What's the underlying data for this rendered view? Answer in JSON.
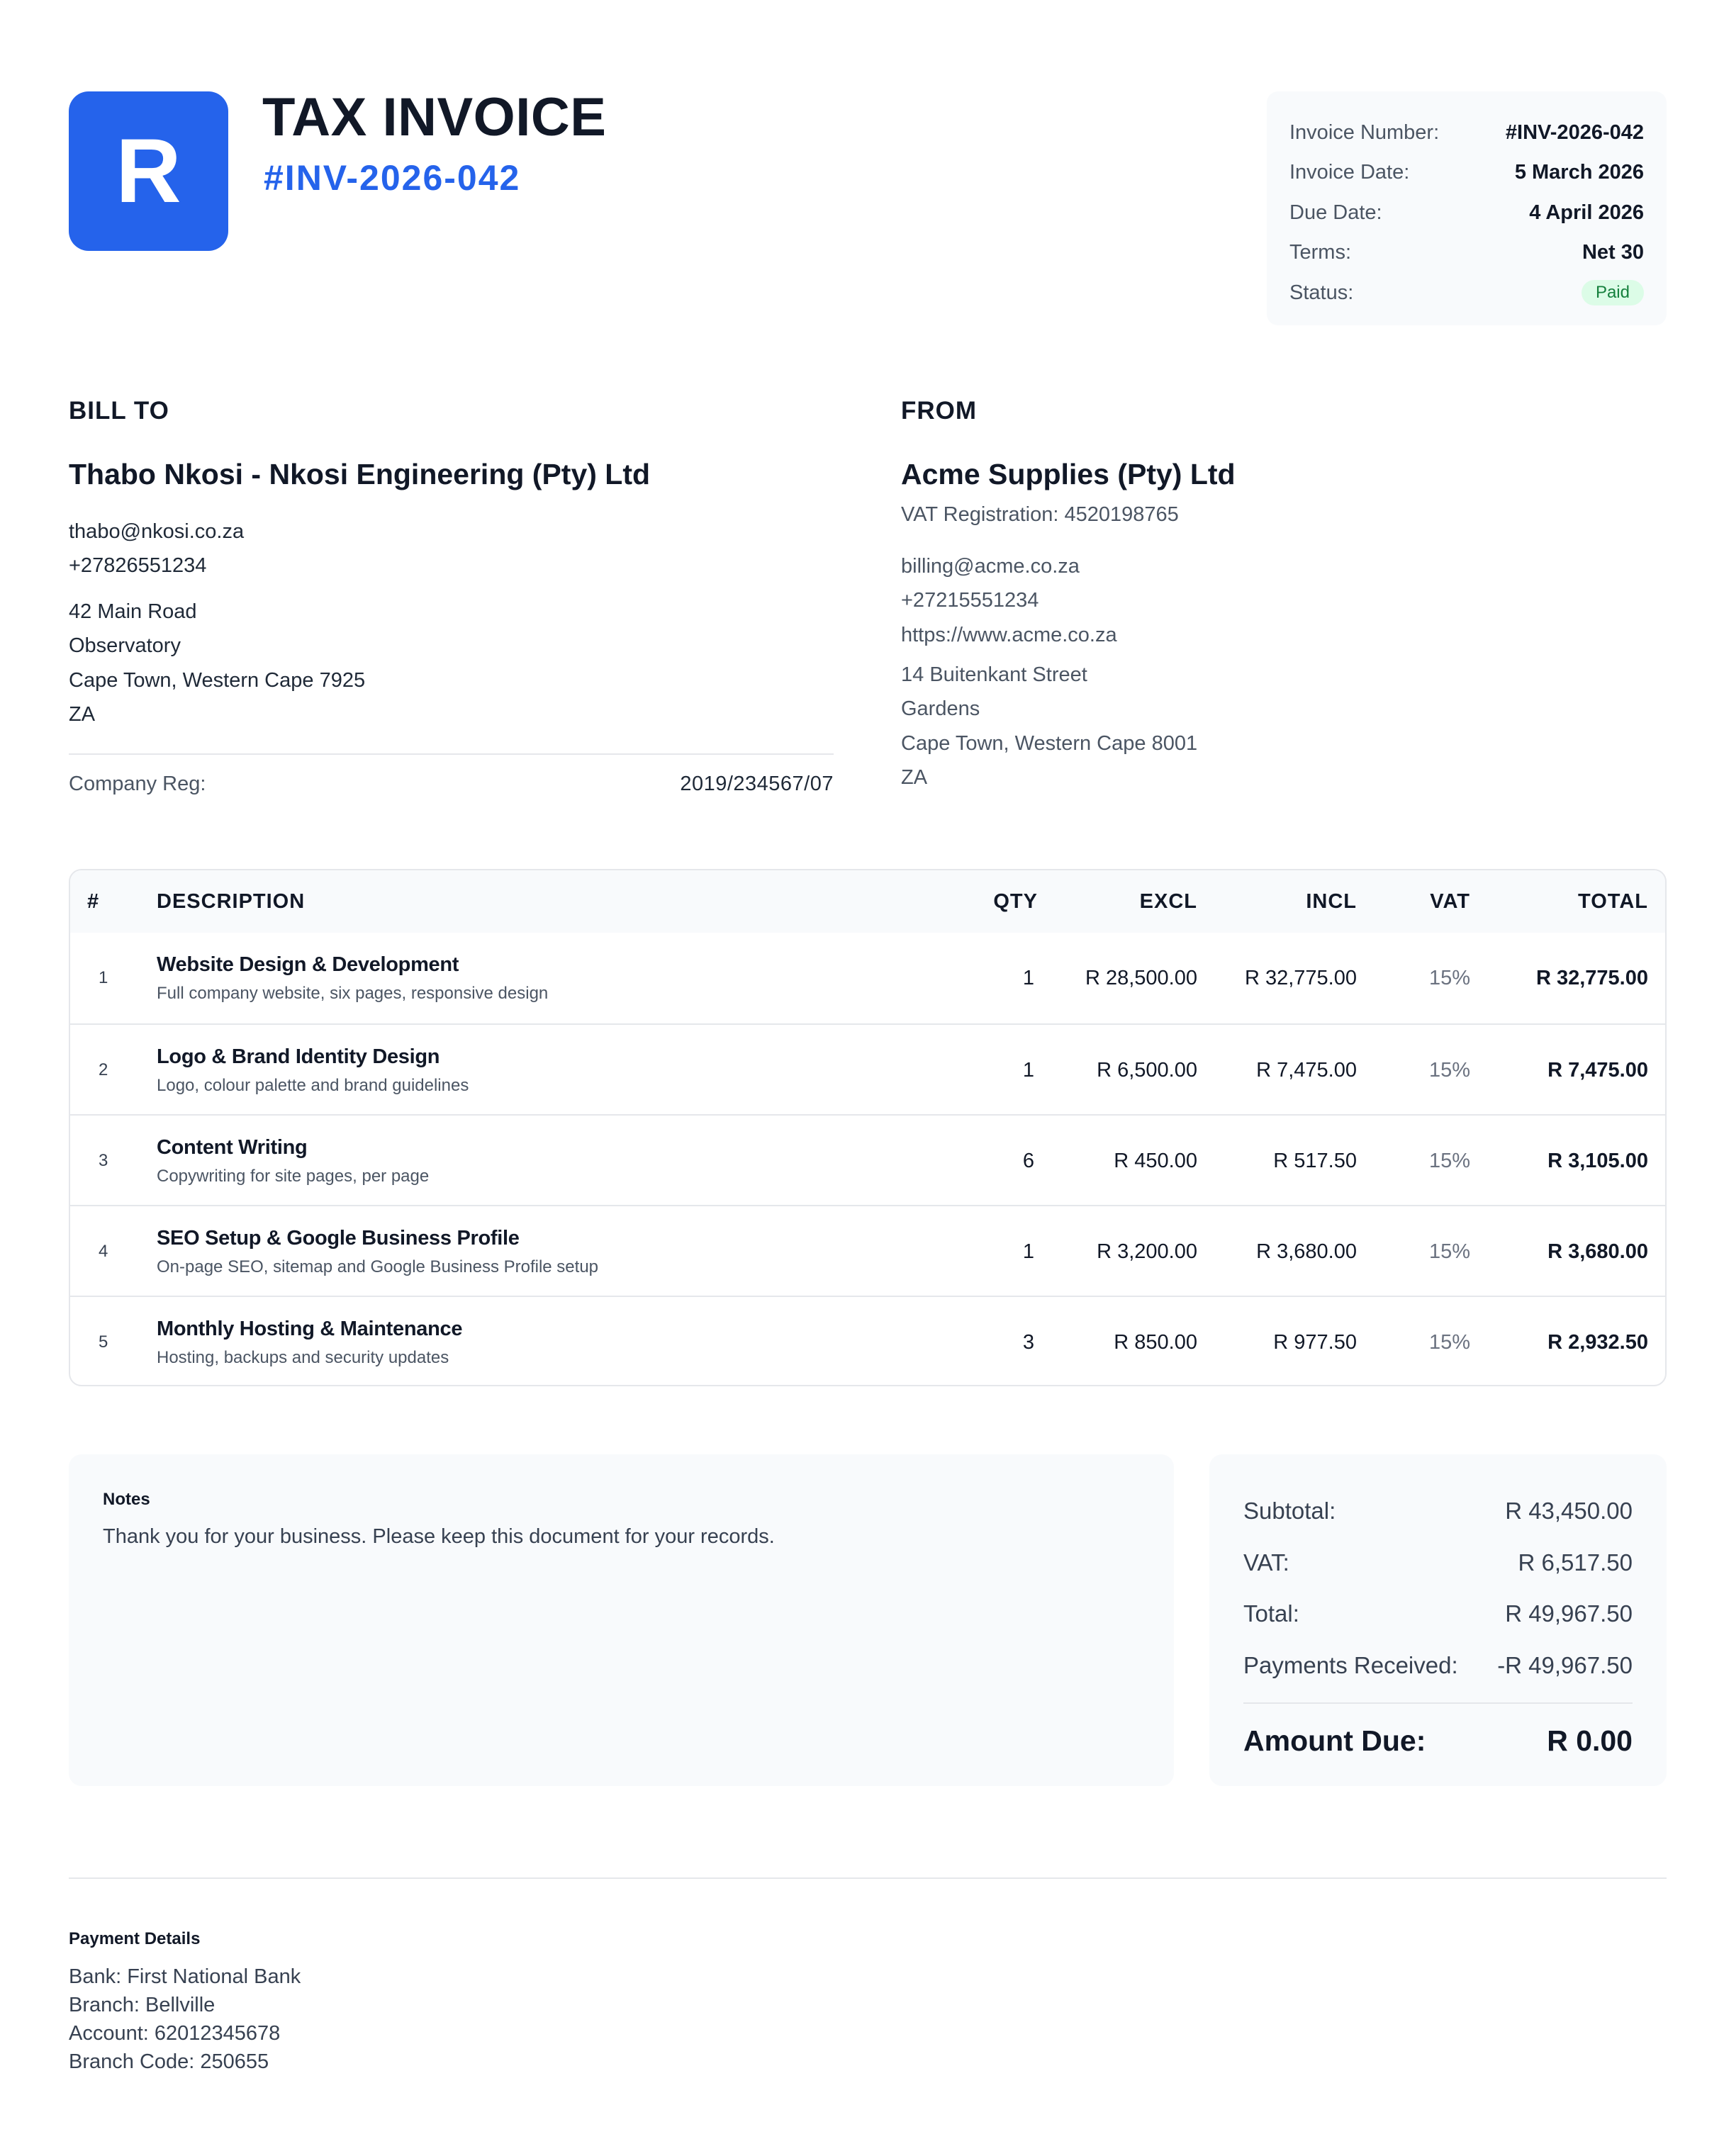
{
  "header": {
    "logo_letter": "R",
    "title": "TAX INVOICE",
    "number": "#INV-2026-042"
  },
  "meta": {
    "invoice_number_label": "Invoice Number:",
    "invoice_number": "#INV-2026-042",
    "invoice_date_label": "Invoice Date:",
    "invoice_date": "5 March 2026",
    "due_date_label": "Due Date:",
    "due_date": "4 April 2026",
    "terms_label": "Terms:",
    "terms": "Net 30",
    "status_label": "Status:",
    "status": "Paid"
  },
  "bill_to": {
    "heading": "BILL TO",
    "name": "Thabo Nkosi - Nkosi Engineering (Pty) Ltd",
    "email": "thabo@nkosi.co.za",
    "phone": "+27826551234",
    "address": [
      "42 Main Road",
      "Observatory",
      "Cape Town, Western Cape 7925",
      "ZA"
    ],
    "reg_label": "Company Reg:",
    "reg_value": "2019/234567/07"
  },
  "from": {
    "heading": "FROM",
    "name": "Acme Supplies (Pty) Ltd",
    "vat_reg": "VAT Registration: 4520198765",
    "email": "billing@acme.co.za",
    "phone": "+27215551234",
    "website": "https://www.acme.co.za",
    "address": [
      "14 Buitenkant Street",
      "Gardens",
      "Cape Town, Western Cape 8001",
      "ZA"
    ]
  },
  "table": {
    "headers": {
      "num": "#",
      "description": "DESCRIPTION",
      "qty": "QTY",
      "excl": "EXCL",
      "incl": "INCL",
      "vat": "VAT",
      "total": "TOTAL"
    },
    "rows": [
      {
        "num": "1",
        "title": "Website Design & Development",
        "sub": "Full company website, six pages, responsive design",
        "qty": "1",
        "excl": "R 28,500.00",
        "incl": "R 32,775.00",
        "vat": "15%",
        "total": "R 32,775.00"
      },
      {
        "num": "2",
        "title": "Logo & Brand Identity Design",
        "sub": "Logo, colour palette and brand guidelines",
        "qty": "1",
        "excl": "R 6,500.00",
        "incl": "R 7,475.00",
        "vat": "15%",
        "total": "R 7,475.00"
      },
      {
        "num": "3",
        "title": "Content Writing",
        "sub": "Copywriting for site pages, per page",
        "qty": "6",
        "excl": "R 450.00",
        "incl": "R 517.50",
        "vat": "15%",
        "total": "R 3,105.00"
      },
      {
        "num": "4",
        "title": "SEO Setup & Google Business Profile",
        "sub": "On-page SEO, sitemap and Google Business Profile setup",
        "qty": "1",
        "excl": "R 3,200.00",
        "incl": "R 3,680.00",
        "vat": "15%",
        "total": "R 3,680.00"
      },
      {
        "num": "5",
        "title": "Monthly Hosting & Maintenance",
        "sub": "Hosting, backups and security updates",
        "qty": "3",
        "excl": "R 850.00",
        "incl": "R 977.50",
        "vat": "15%",
        "total": "R 2,932.50"
      }
    ]
  },
  "notes": {
    "heading": "Notes",
    "text": "Thank you for your business. Please keep this document for your records."
  },
  "totals": {
    "subtotal_label": "Subtotal:",
    "subtotal": "R 43,450.00",
    "vat_label": "VAT:",
    "vat": "R 6,517.50",
    "total_label": "Total:",
    "total": "R 49,967.50",
    "payments_label": "Payments Received:",
    "payments": "-R 49,967.50",
    "due_label": "Amount Due:",
    "due": "R 0.00"
  },
  "payment": {
    "heading": "Payment Details",
    "lines": [
      "Bank: First National Bank",
      "Branch: Bellville",
      "Account: 62012345678",
      "Branch Code: 250655"
    ]
  }
}
